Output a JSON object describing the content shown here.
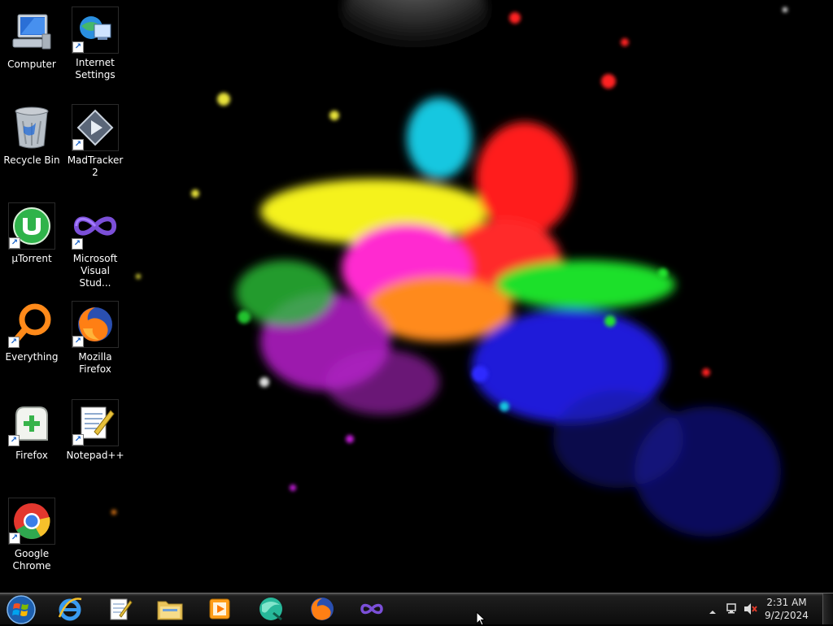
{
  "desktop": {
    "icons": [
      {
        "label": "Computer",
        "icon": "computer-icon",
        "shortcut": false
      },
      {
        "label": "Internet Settings",
        "icon": "internet-settings-icon",
        "shortcut": true
      },
      {
        "label": "Recycle Bin",
        "icon": "recycle-bin-icon",
        "shortcut": false
      },
      {
        "label": "MadTracker 2",
        "icon": "madtracker-icon",
        "shortcut": true
      },
      {
        "label": "µTorrent",
        "icon": "utorrent-icon",
        "shortcut": true
      },
      {
        "label": "Microsoft Visual Stud...",
        "icon": "visual-studio-icon",
        "shortcut": true
      },
      {
        "label": "Everything",
        "icon": "everything-search-icon",
        "shortcut": true
      },
      {
        "label": "Mozilla Firefox",
        "icon": "firefox-icon",
        "shortcut": true
      },
      {
        "label": "Firefox",
        "icon": "firefox-profile-icon",
        "shortcut": true
      },
      {
        "label": "Notepad++",
        "icon": "notepadpp-icon",
        "shortcut": true
      },
      {
        "label": "Google Chrome",
        "icon": "chrome-icon",
        "shortcut": true
      }
    ]
  },
  "taskbar": {
    "start": {
      "icon": "windows-start-orb-icon"
    },
    "pinned": [
      {
        "icon": "internet-explorer-icon"
      },
      {
        "icon": "notepad-icon"
      },
      {
        "icon": "file-explorer-icon"
      },
      {
        "icon": "media-player-icon"
      },
      {
        "icon": "green-sphere-icon"
      },
      {
        "icon": "firefox-icon"
      },
      {
        "icon": "visual-studio-icon"
      }
    ],
    "tray": {
      "icons": [
        "show-hidden-icons-arrow-icon",
        "network-icon",
        "volume-muted-icon"
      ],
      "time": "2:31 AM",
      "date": "9/2/2024"
    }
  },
  "colors": {
    "taskbar": "#0c0c0c",
    "splash": [
      "#ffff1e",
      "#ff1f1f",
      "#22e32f",
      "#ff2bd0",
      "#2d2bff",
      "#19d3e8",
      "#ff8c1a"
    ]
  }
}
